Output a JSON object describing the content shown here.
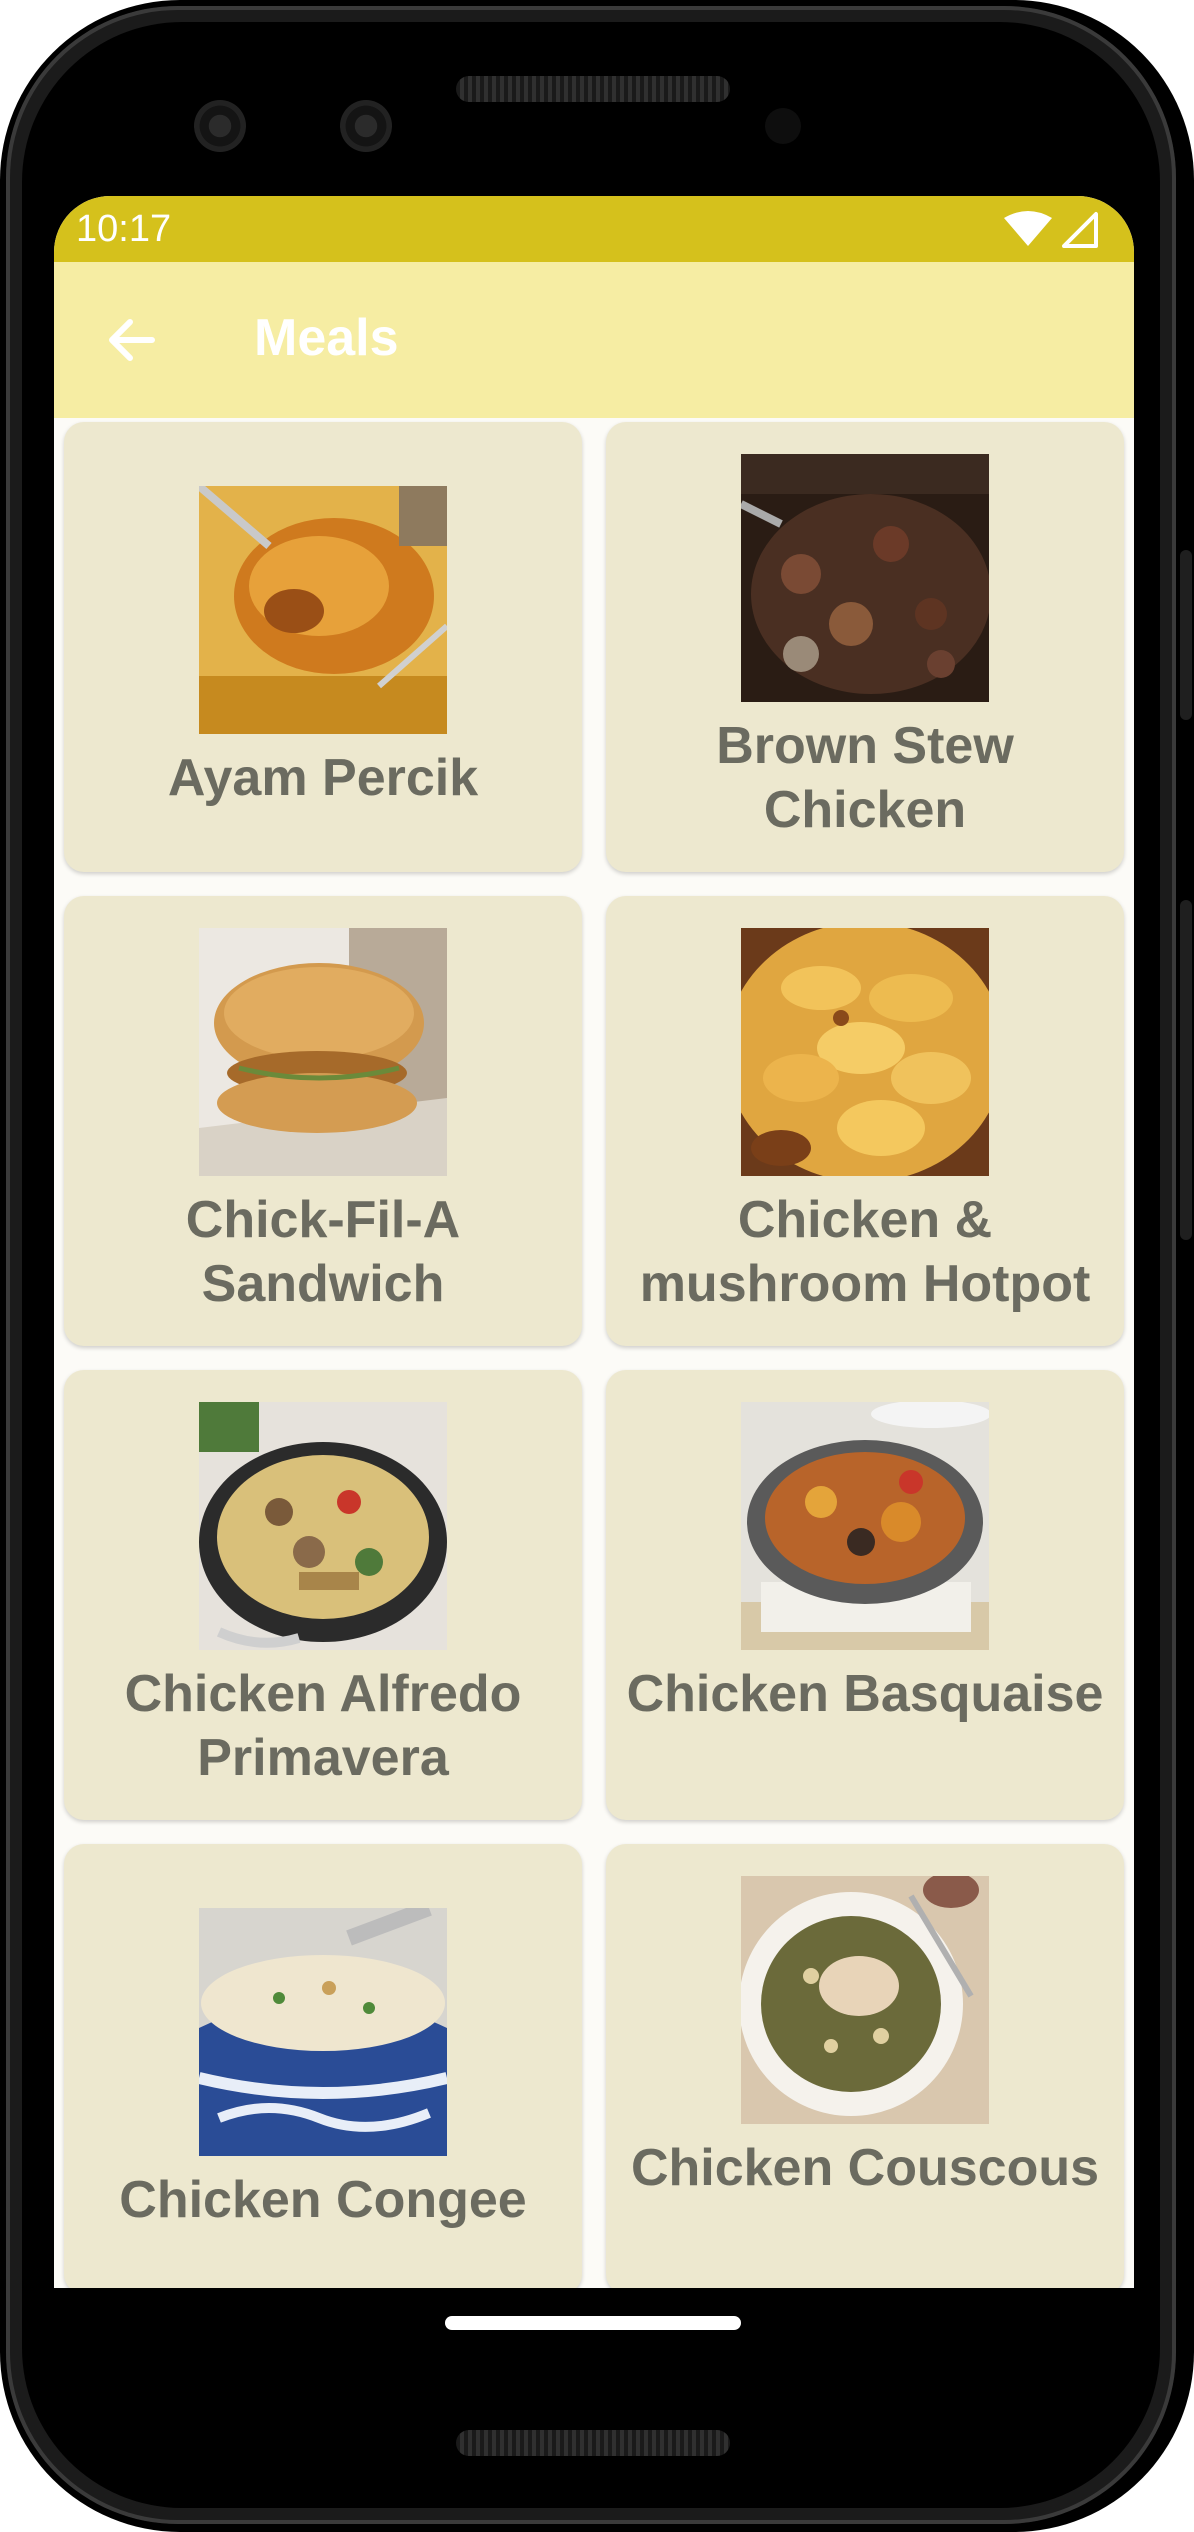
{
  "status_bar": {
    "time": "10:17",
    "wifi_icon": "wifi-icon",
    "signal_icon": "cell-signal-icon"
  },
  "app_bar": {
    "title": "Meals",
    "back_icon": "arrow-back-icon"
  },
  "meals": [
    {
      "name": "Ayam Percik"
    },
    {
      "name": "Brown Stew Chicken"
    },
    {
      "name": "Chick-Fil-A Sandwich"
    },
    {
      "name": "Chicken & mushroom Hotpot"
    },
    {
      "name": "Chicken Alfredo Primavera"
    },
    {
      "name": "Chicken Basquaise"
    },
    {
      "name": "Chicken Congee"
    },
    {
      "name": "Chicken Couscous"
    }
  ],
  "colors": {
    "status_bar": "#d5c11c",
    "app_bar": "#f6eda3",
    "card": "#ede8cf",
    "card_text": "#6b6b60",
    "title_text": "#ffffff"
  }
}
